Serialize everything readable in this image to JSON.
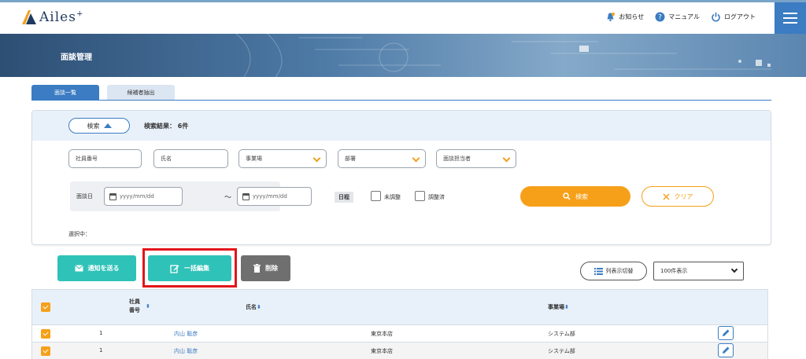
{
  "header": {
    "logo_text": "Ailes",
    "logo_plus": "+",
    "links": {
      "notice": "お知らせ",
      "manual": "マニュアル",
      "logout": "ログアウト"
    }
  },
  "banner": {
    "title": "面談管理"
  },
  "tabs": [
    {
      "label": "面談一覧"
    },
    {
      "label": "候補者抽出"
    }
  ],
  "search": {
    "toggle_label": "検索",
    "result_label": "検索結果：",
    "result_count": "6件",
    "employee_no_placeholder": "社員番号",
    "name_placeholder": "氏名",
    "site_select": "事業場",
    "dept_select": "部署",
    "interviewer_select": "面談担当者",
    "date_label": "面談日",
    "date_from_placeholder": "yyyy/mm/dd",
    "date_tilde": "～",
    "date_to_placeholder": "yyyy/mm/dd",
    "schedule_label": "日程",
    "unadjusted_label": "未調整",
    "adjusted_label": "調整済",
    "search_button": "検索",
    "clear_button": "クリア",
    "selected_label": "選択中："
  },
  "actions": {
    "notify_button": "通知を送る",
    "bulk_edit_button": "一括編集",
    "delete_button": "削除",
    "columns_button": "列表示切替",
    "per_page_value": "100件表示"
  },
  "table": {
    "headers": {
      "employee_no_line1": "社員",
      "employee_no_line2": "番号",
      "name": "氏名",
      "site": "事業場"
    },
    "rows": [
      {
        "no": "1",
        "name": "内山 聡彦",
        "office": "東京本店",
        "site": "システム部"
      },
      {
        "no": "1",
        "name": "内山 聡彦",
        "office": "東京本店",
        "site": "システム部"
      }
    ]
  },
  "colors": {
    "accent": "#3b7cc2",
    "orange": "#f6a019",
    "teal": "#2fc2b8",
    "highlight": "#e3141b"
  }
}
